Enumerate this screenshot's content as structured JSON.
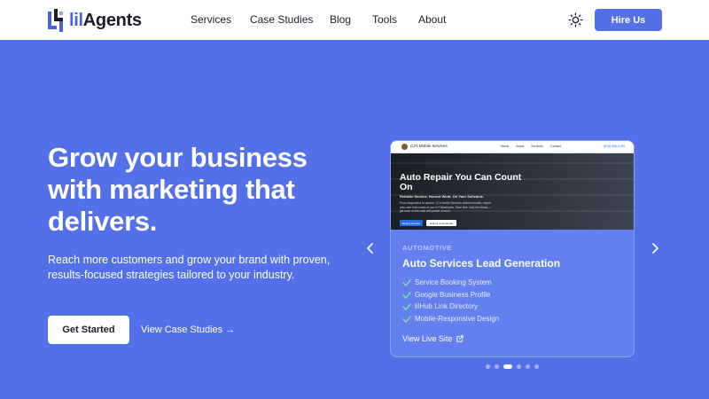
{
  "brand": {
    "name_prefix": "lil",
    "name_suffix": "Agents",
    "accent_color": "#5470e8"
  },
  "nav": {
    "links": [
      {
        "label": "Services"
      },
      {
        "label": "Case Studies"
      },
      {
        "label": "Blog"
      },
      {
        "label": "Tools"
      },
      {
        "label": "About"
      }
    ],
    "theme_icon": "sun-icon",
    "cta_label": "Hire Us"
  },
  "hero": {
    "title_lines": [
      "Grow your business",
      "with marketing that",
      "delivers."
    ],
    "subtitle": "Reach more customers and grow your brand with proven, results-focused strategies tailored to your industry.",
    "primary_button": "Get Started",
    "secondary_link": "View Case Studies →"
  },
  "carousel": {
    "prev_icon": "chevron-left-icon",
    "next_icon": "chevron-right-icon",
    "active_index": 2,
    "dot_count": 6,
    "card": {
      "preview": {
        "site_name": "CJ's Mobile Services",
        "menu": [
          "Home",
          "About",
          "Services",
          "Contact"
        ],
        "phone": "(614) 555-0199",
        "headline": "Auto Repair You Can Count On",
        "tagline": "Reliable Service. Honest Work. On Your Schedule.",
        "description": "From diagnostics to repairs, CJ's Mobile Services delivers trusted, expert auto care that comes to you in Philadelphia. Save time, skip the stress — get back on the road with peace of mind.",
        "button_primary": "Book a Service",
        "button_secondary": "Call for an Estimate"
      },
      "category": "AUTOMOTIVE",
      "title": "Auto Services Lead Generation",
      "features": [
        "Service Booking System",
        "Google Business Profile",
        "lilHub Link Directory",
        "Mobile-Responsive Design"
      ],
      "link_label": "View Live Site"
    }
  }
}
